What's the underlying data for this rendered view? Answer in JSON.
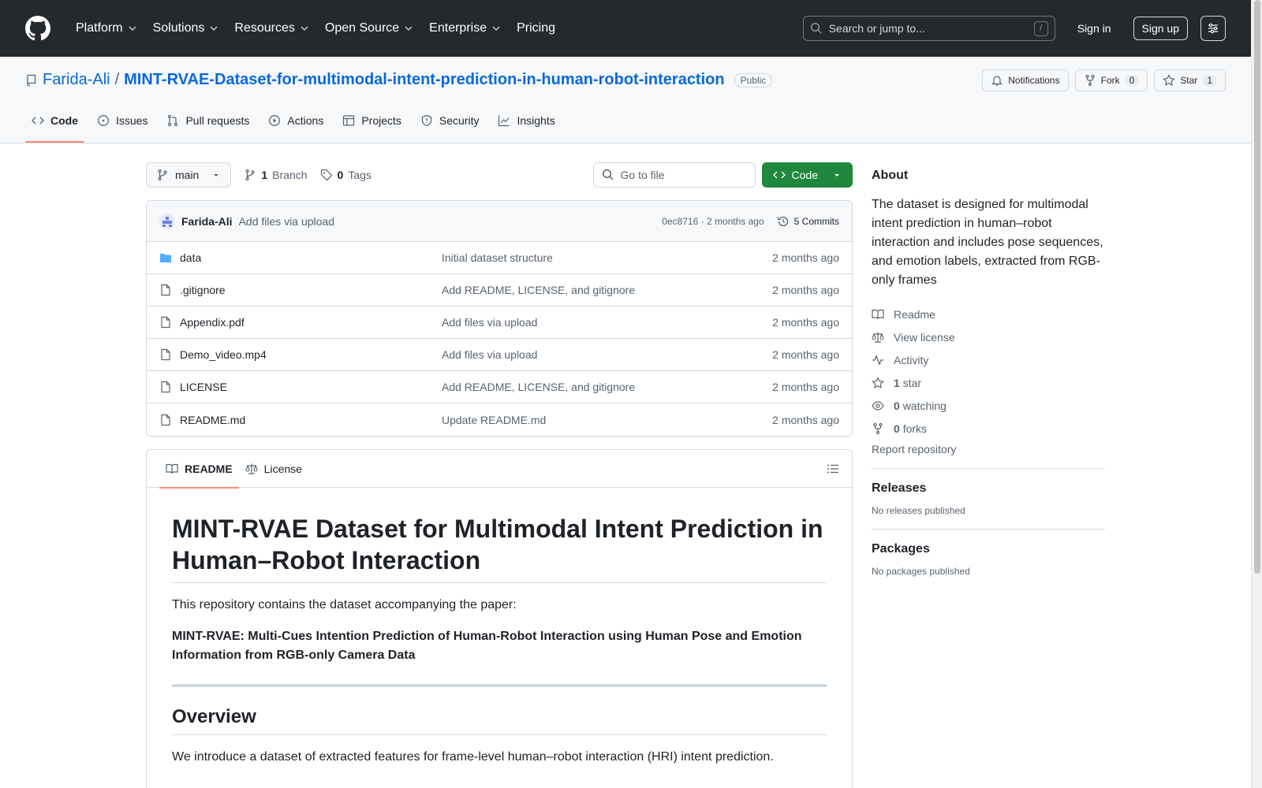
{
  "header": {
    "nav": [
      "Platform",
      "Solutions",
      "Resources",
      "Open Source",
      "Enterprise",
      "Pricing"
    ],
    "search_placeholder": "Search or jump to...",
    "search_key": "/",
    "signin": "Sign in",
    "signup": "Sign up"
  },
  "repo": {
    "owner": "Farida-Ali",
    "separator": "/",
    "name": "MINT-RVAE-Dataset-for-multimodal-intent-prediction-in-human-robot-interaction",
    "visibility": "Public",
    "notifications_label": "Notifications",
    "fork_label": "Fork",
    "fork_count": "0",
    "star_label": "Star",
    "star_count": "1",
    "tabs": [
      "Code",
      "Issues",
      "Pull requests",
      "Actions",
      "Projects",
      "Security",
      "Insights"
    ]
  },
  "toolbar": {
    "branch": "main",
    "branch_count": "1",
    "branch_label": "Branch",
    "tag_count": "0",
    "tag_label": "Tags",
    "goto_placeholder": "Go to file",
    "code_label": "Code"
  },
  "commit": {
    "author": "Farida-Ali",
    "message": "Add files via upload",
    "meta": "0ec8716 · 2 months ago",
    "commits_label": "5 Commits"
  },
  "files": [
    {
      "name": "data",
      "type": "folder",
      "commit": "Initial dataset structure",
      "age": "2 months ago"
    },
    {
      "name": ".gitignore",
      "type": "file",
      "commit": "Add README, LICENSE, and gitignore",
      "age": "2 months ago"
    },
    {
      "name": "Appendix.pdf",
      "type": "file",
      "commit": "Add files via upload",
      "age": "2 months ago"
    },
    {
      "name": "Demo_video.mp4",
      "type": "file",
      "commit": "Add files via upload",
      "age": "2 months ago"
    },
    {
      "name": "LICENSE",
      "type": "file",
      "commit": "Add README, LICENSE, and gitignore",
      "age": "2 months ago"
    },
    {
      "name": "README.md",
      "type": "file",
      "commit": "Update README.md",
      "age": "2 months ago"
    }
  ],
  "readme": {
    "tab_readme": "README",
    "tab_license": "License",
    "title": "MINT-RVAE Dataset for Multimodal Intent Prediction in Human–Robot Interaction",
    "intro": "This repository contains the dataset accompanying the paper:",
    "paper": "MINT-RVAE: Multi-Cues Intention Prediction of Human-Robot Interaction using Human Pose and Emotion Information from RGB-only Camera Data",
    "overview_heading": "Overview",
    "overview_text": "We introduce a dataset of extracted features for frame-level human–robot interaction (HRI) intent prediction."
  },
  "sidebar": {
    "about_heading": "About",
    "about_text": "The dataset is designed for multimodal intent prediction in human–robot interaction and includes pose sequences, and emotion labels, extracted from RGB-only frames",
    "readme": "Readme",
    "license": "View license",
    "activity": "Activity",
    "stars_count": "1",
    "stars_label": "star",
    "watching_count": "0",
    "watching_label": "watching",
    "forks_count": "0",
    "forks_label": "forks",
    "report": "Report repository",
    "releases_heading": "Releases",
    "releases_text": "No releases published",
    "packages_heading": "Packages",
    "packages_text": "No packages published"
  },
  "colors": {
    "header_bg": "#25292e",
    "link": "#0969da",
    "code_button": "#1f883d",
    "tab_underline": "#fd8c73"
  }
}
